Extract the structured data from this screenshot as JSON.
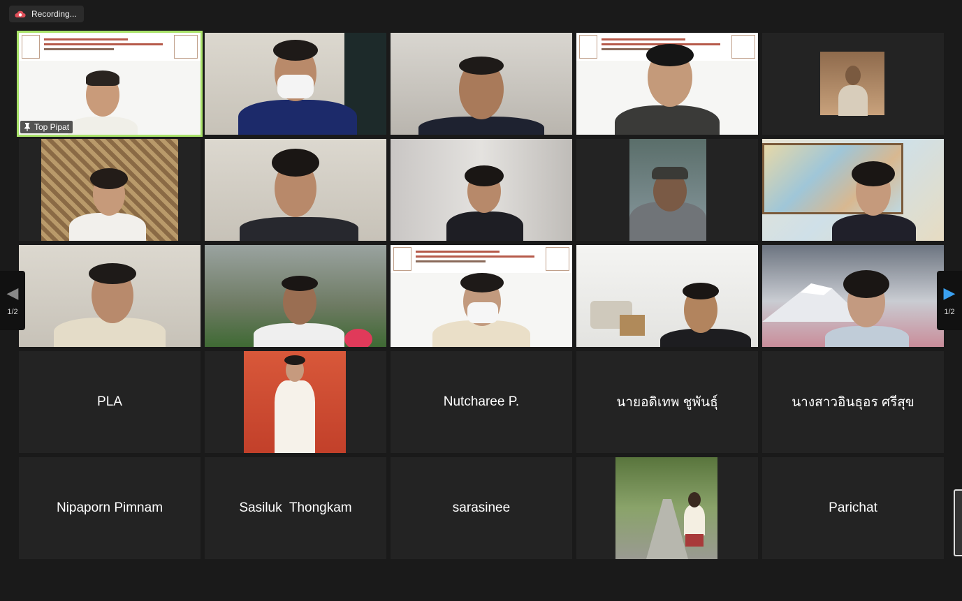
{
  "recording": {
    "label": "Recording...",
    "icon": "cloud-recording-icon"
  },
  "pagination": {
    "left_label": "1/2",
    "right_label": "1/2"
  },
  "colors": {
    "active_speaker": "#a9e26a",
    "next_arrow": "#3aa0f0",
    "tile_bg": "#232323"
  },
  "participants": [
    {
      "name": "Top Pipat",
      "video": true,
      "pinned": true
    },
    {
      "video": true
    },
    {
      "video": true
    },
    {
      "video": true
    },
    {
      "video": true,
      "avatar": true
    },
    {
      "video": true
    },
    {
      "video": true
    },
    {
      "video": true
    },
    {
      "video": true
    },
    {
      "video": true
    },
    {
      "video": true
    },
    {
      "video": true
    },
    {
      "video": true
    },
    {
      "video": true
    },
    {
      "video": true
    },
    {
      "name": "PLA",
      "video": false
    },
    {
      "video": false,
      "avatar": true
    },
    {
      "name": "Nutcharee P.",
      "video": false
    },
    {
      "name": "นายอดิเทพ ชูพันธุ์",
      "video": false
    },
    {
      "name": "นางสาวอินธุอร ศรีสุข",
      "video": false
    },
    {
      "name": "Nipaporn Pimnam",
      "video": false
    },
    {
      "name": "Sasiluk  Thongkam",
      "video": false
    },
    {
      "name": "sarasinee",
      "video": false
    },
    {
      "video": false,
      "avatar": true
    },
    {
      "name": "Parichat",
      "video": false
    }
  ]
}
